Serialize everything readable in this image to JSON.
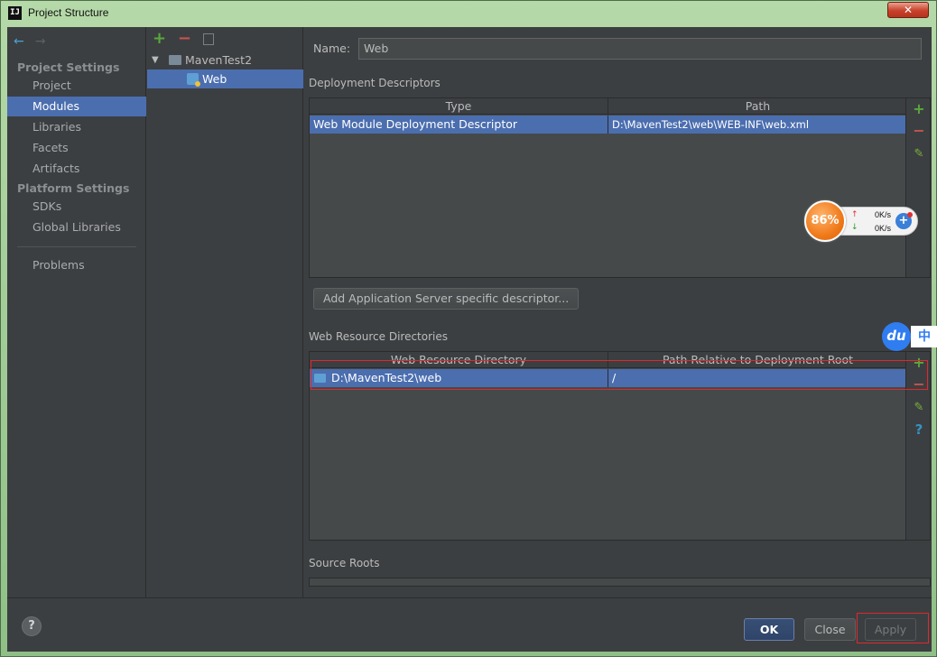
{
  "window": {
    "title": "Project Structure",
    "app_icon": "IJ",
    "close_glyph": "✕"
  },
  "nav": {
    "back_icon": "←",
    "forward_icon": "→",
    "project_settings_heading": "Project Settings",
    "platform_settings_heading": "Platform Settings",
    "items": {
      "project": "Project",
      "modules": "Modules",
      "libraries": "Libraries",
      "facets": "Facets",
      "artifacts": "Artifacts",
      "sdks": "SDKs",
      "global_libraries": "Global Libraries",
      "problems": "Problems"
    },
    "selected": "Modules"
  },
  "tree": {
    "add_icon": "+",
    "remove_icon": "−",
    "root": "MavenTest2",
    "child": "Web",
    "expanded_glyph": "▼"
  },
  "panel": {
    "name_label": "Name:",
    "name_value": "Web",
    "deployment_descriptors": {
      "label": "Deployment Descriptors",
      "columns": [
        "Type",
        "Path"
      ],
      "rows": [
        {
          "type": "Web Module Deployment Descriptor",
          "path": "D:\\MavenTest2\\web\\WEB-INF\\web.xml"
        }
      ]
    },
    "add_server_descriptor_button": "Add Application Server specific descriptor...",
    "web_resource_directories": {
      "label": "Web Resource Directories",
      "columns": [
        "Web Resource Directory",
        "Path Relative to Deployment Root"
      ],
      "rows": [
        {
          "directory": "D:\\MavenTest2\\web",
          "relative": "/"
        }
      ]
    },
    "source_roots_label": "Source Roots",
    "side_tools": {
      "add": "+",
      "remove": "−",
      "edit": "✎",
      "help": "?"
    }
  },
  "bottom": {
    "help": "?",
    "ok": "OK",
    "close": "Close",
    "apply": "Apply"
  },
  "overlays": {
    "speed_widget": {
      "percent": "86%",
      "up_speed": "0K/s",
      "down_speed": "0K/s",
      "up_arrow": "↑",
      "down_arrow": "↓",
      "plus": "+"
    },
    "du_widget": {
      "logo": "du",
      "text": "中"
    }
  },
  "colors": {
    "selection": "#4b6eaf",
    "panel_bg": "#3c3f41",
    "highlight_box": "#e0282d",
    "add_green": "#59a83c",
    "remove_red": "#c75450"
  }
}
